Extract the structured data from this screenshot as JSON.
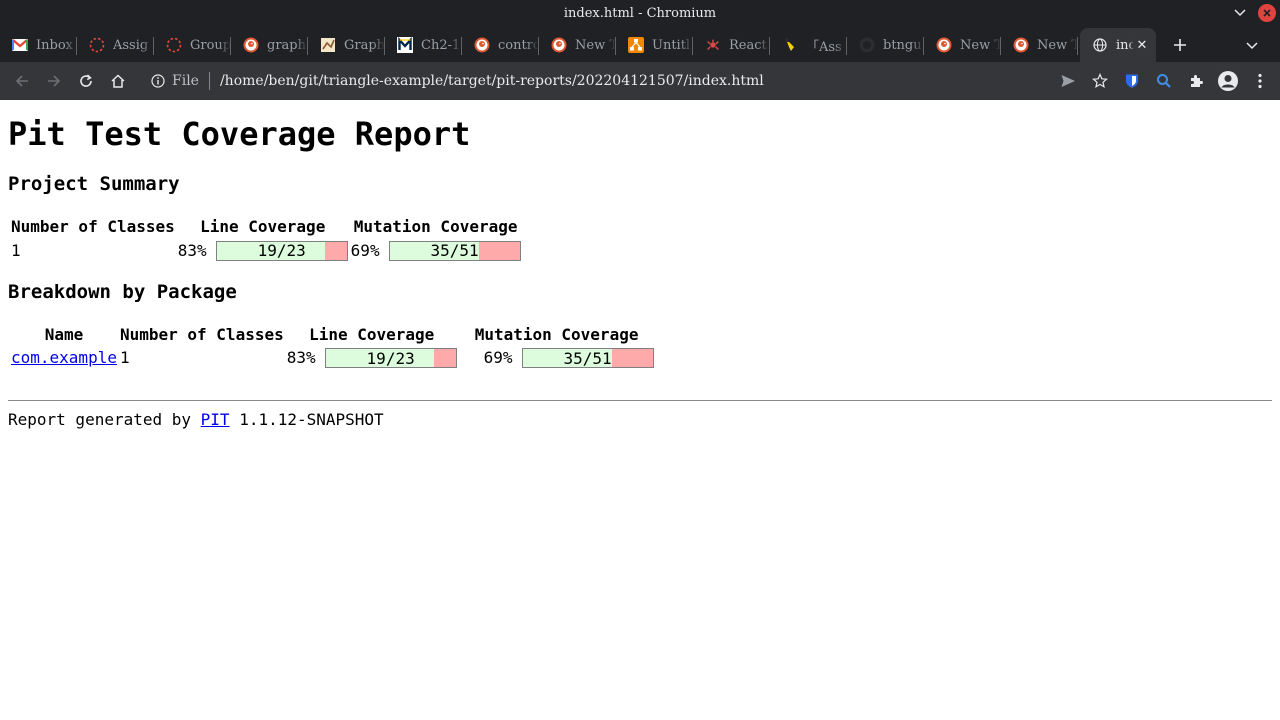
{
  "window": {
    "title": "index.html - Chromium"
  },
  "tabs": [
    {
      "label": "Inbox",
      "icon": "gmail-icon"
    },
    {
      "label": "Assig",
      "icon": "loading-icon"
    },
    {
      "label": "Group",
      "icon": "loading-icon"
    },
    {
      "label": "graph",
      "icon": "duckduckgo-icon"
    },
    {
      "label": "Graph",
      "icon": "graph-icon"
    },
    {
      "label": "Ch2-1",
      "icon": "m-logo-icon"
    },
    {
      "label": "contro",
      "icon": "duckduckgo-icon"
    },
    {
      "label": "New T",
      "icon": "duckduckgo-icon"
    },
    {
      "label": "Untitl",
      "icon": "drawio-icon"
    },
    {
      "label": "React",
      "icon": "react-icon"
    },
    {
      "label": "「Ass",
      "icon": "pin-icon"
    },
    {
      "label": "btngu",
      "icon": "github-icon"
    },
    {
      "label": "New T",
      "icon": "duckduckgo-icon"
    },
    {
      "label": "New T",
      "icon": "duckduckgo-icon"
    }
  ],
  "active_tab": {
    "label": "inde",
    "icon": "globe-icon"
  },
  "toolbar": {
    "scheme": "File",
    "url": "/home/ben/git/triangle-example/target/pit-reports/202204121507/index.html"
  },
  "report": {
    "title": "Pit Test Coverage Report",
    "project_summary": {
      "heading": "Project Summary",
      "headers": [
        "Number of Classes",
        "Line Coverage",
        "Mutation Coverage"
      ],
      "classes": "1",
      "line": {
        "pct": "83%",
        "text": "19/23",
        "fraction": 0.83
      },
      "mutation": {
        "pct": "69%",
        "text": "35/51",
        "fraction": 0.69
      }
    },
    "breakdown": {
      "heading": "Breakdown by Package",
      "headers": [
        "Name",
        "Number of Classes",
        "Line Coverage",
        "Mutation Coverage"
      ],
      "rows": [
        {
          "name": "com.example",
          "classes": "1",
          "line": {
            "pct": "83%",
            "text": "19/23",
            "fraction": 0.83
          },
          "mutation": {
            "pct": "69%",
            "text": "35/51",
            "fraction": 0.69
          }
        }
      ]
    },
    "footer": {
      "prefix": "Report generated by ",
      "link": "PIT",
      "suffix": " 1.1.12-SNAPSHOT"
    }
  },
  "colors": {
    "covered": "#ddfbdd",
    "uncovered": "#ffaaaa",
    "link": "#0000ee"
  }
}
